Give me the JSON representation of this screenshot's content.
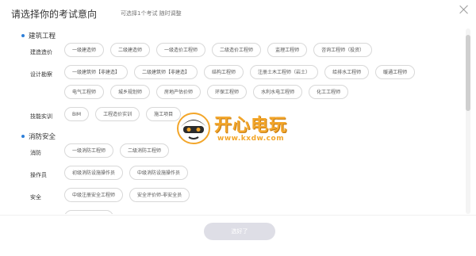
{
  "header": {
    "title": "请选择你的考试意向",
    "subtitle": "可选择1个考试 随时调整"
  },
  "categories": [
    {
      "title": "建筑工程",
      "groups": [
        {
          "label": "建造造价",
          "chips": [
            "一级建造师",
            "二级建造师",
            "一级造价工程师",
            "二级造价工程师",
            "监理工程师",
            "咨询工程师（投资）"
          ]
        },
        {
          "label": "设计勘察",
          "chips": [
            "一级建筑师【非建造】",
            "二级建筑师【非建造】",
            "结构工程师",
            "注册土木工程师（岩土）",
            "给排水工程师",
            "暖通工程师",
            "电气工程师",
            "城乡规划师",
            "房地产估价师",
            "环保工程师",
            "水利水电工程师",
            "化工工程师"
          ]
        },
        {
          "label": "技能实训",
          "chips": [
            "BIM",
            "工程造价实训",
            "施工项目"
          ]
        }
      ]
    },
    {
      "title": "消防安全",
      "groups": [
        {
          "label": "消防",
          "chips": [
            "一级消防工程师",
            "二级消防工程师"
          ]
        },
        {
          "label": "操作员",
          "chips": [
            "初级消防设施操作员",
            "中级消防设施操作员"
          ]
        },
        {
          "label": "安全",
          "chips": [
            "中级注册安全工程师",
            "安全评价师-非安全员"
          ]
        },
        {
          "label": "",
          "chips": [
            ""
          ]
        }
      ]
    }
  ],
  "footer": {
    "confirm_label": "选好了"
  },
  "watermark": {
    "title": "开心电玩",
    "url": "www.kxdw.com"
  },
  "colors": {
    "accent": "#2d7fd9",
    "watermark": "#f3a62a",
    "button_disabled": "#dedee6"
  }
}
